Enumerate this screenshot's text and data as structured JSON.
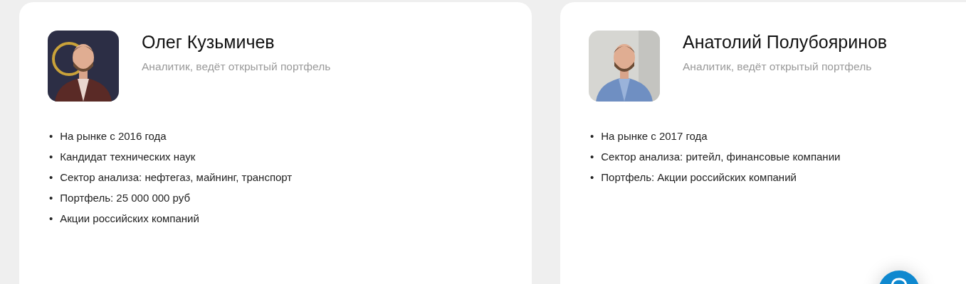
{
  "analysts": [
    {
      "name": "Олег Кузьмичев",
      "role": "Аналитик, ведёт открытый портфель",
      "bullet": "•",
      "facts": [
        "На рынке с 2016 года",
        "Кандидат технических наук",
        "Сектор анализа: нефтегаз, майнинг, транспорт",
        "Портфель: 25 000 000 руб",
        "Акции российских компаний"
      ]
    },
    {
      "name": "Анатолий Полубояринов",
      "role": "Аналитик, ведёт открытый портфель",
      "bullet": "•",
      "facts": [
        "На рынке с 2017 года",
        "Сектор анализа: ритейл, финансовые компании",
        "Портфель: Акции российских компаний"
      ]
    }
  ]
}
